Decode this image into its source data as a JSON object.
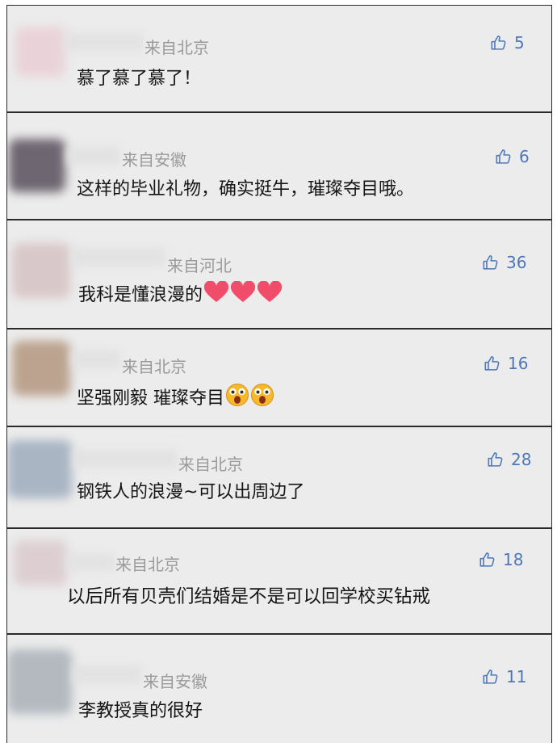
{
  "comments": [
    {
      "location": "来自北京",
      "text": "慕了慕了慕了！",
      "likes": "5"
    },
    {
      "location": "来自安徽",
      "text": "这样的毕业礼物，确实挺牛，璀璨夺目哦。",
      "likes": "6"
    },
    {
      "location": "来自河北",
      "text": "我科是懂浪漫的",
      "likes": "36",
      "emoji": [
        "heart-emoji",
        "heart-emoji",
        "heart-emoji"
      ]
    },
    {
      "location": "来自北京",
      "text": "坚强刚毅 璀璨夺目",
      "likes": "16",
      "emoji": [
        "surprised-face-emoji",
        "surprised-face-emoji"
      ]
    },
    {
      "location": "来自北京",
      "text": "钢铁人的浪漫~可以出周边了",
      "likes": "28"
    },
    {
      "location": "来自北京",
      "text": "以后所有贝壳们结婚是不是可以回学校买钻戒",
      "likes": "18"
    },
    {
      "location": "来自安徽",
      "text": "李教授真的很好",
      "likes": "11"
    }
  ],
  "icons": {
    "like": "thumbs-up-icon"
  },
  "colors": {
    "card_bg": "#ececec",
    "border": "#2a2a2a",
    "like": "#4d78b8",
    "location": "#9a9a9a",
    "text": "#151515"
  }
}
